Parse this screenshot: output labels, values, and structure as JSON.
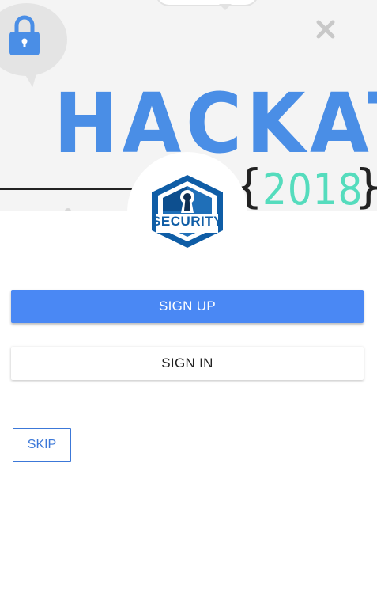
{
  "hero": {
    "title": "HACKATHON",
    "year": "2018",
    "brace_left": "{",
    "brace_right": "}",
    "lock_icon": "lock-icon",
    "close_icon": "close-icon"
  },
  "logo": {
    "text": "SECURITY",
    "icon": "keyhole-hexagon-icon"
  },
  "buttons": {
    "sign_up": "SIGN UP",
    "sign_in": "SIGN IN",
    "skip": "SKIP"
  },
  "colors": {
    "primary": "#4a88f4",
    "hero_title": "#4a8ee6",
    "hero_year": "#55dcbd",
    "logo_blue": "#0f5da6",
    "skip_border": "#3c78d8"
  }
}
